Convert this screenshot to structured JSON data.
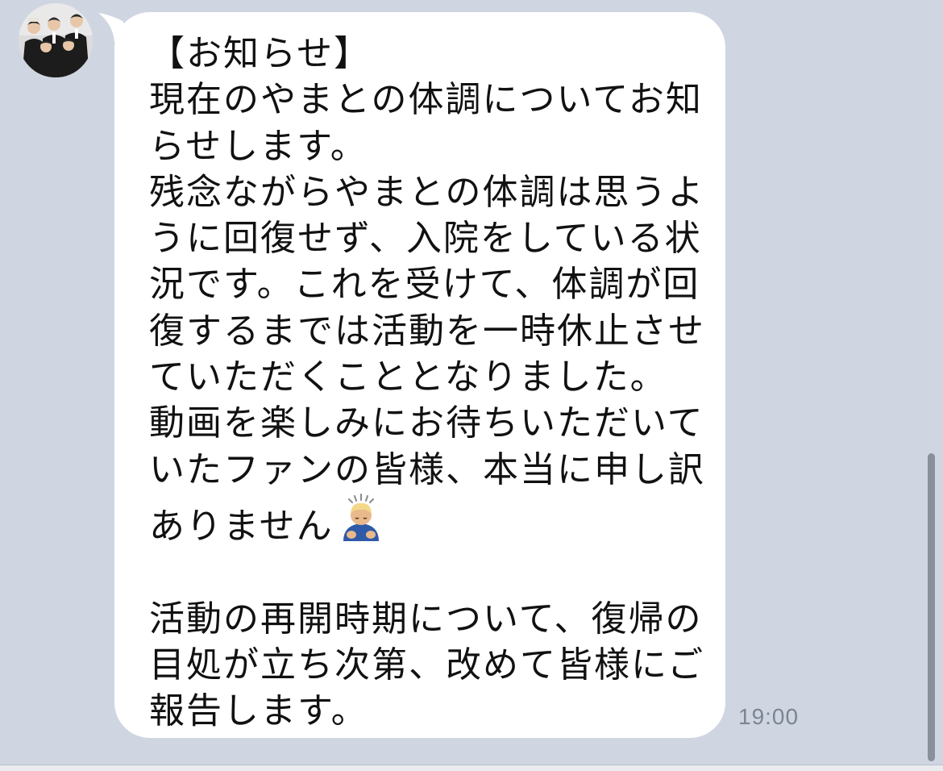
{
  "colors": {
    "background": "#cfd6e1",
    "bubble": "#ffffff",
    "text": "#111111",
    "timestamp": "#7a8594",
    "scrollbar": "#8a9099"
  },
  "message": {
    "sender_avatar_icon": "group-photo-avatar",
    "lines_before_emoji": "【お知らせ】\n現在のやまとの体調についてお知らせします。\n残念ながらやまとの体調は思うように回復せず、入院をしている状況です。これを受けて、体調が回復するまでは活動を一時休止させていただくこととなりました。\n動画を楽しみにお待ちいただいていたファンの皆様、本当に申し訳ありません",
    "emoji": "bowing-person-icon",
    "lines_after_emoji": "\n\n活動の再開時期について、復帰の目処が立ち次第、改めて皆様にご報告します。",
    "time": "19:00"
  }
}
